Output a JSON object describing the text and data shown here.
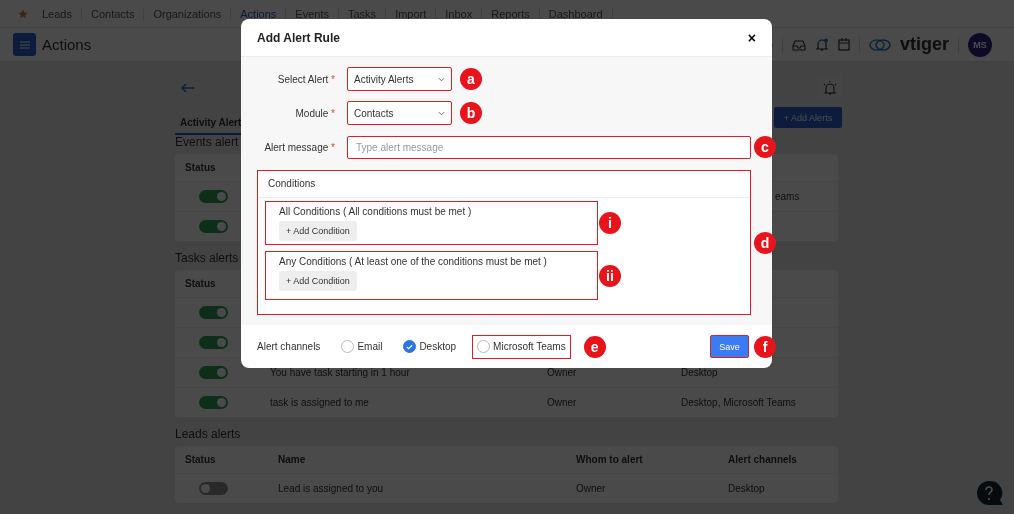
{
  "nav": {
    "items": [
      {
        "label": "Leads",
        "selected": false
      },
      {
        "label": "Contacts",
        "selected": false
      },
      {
        "label": "Organizations",
        "selected": false
      },
      {
        "label": "Actions",
        "selected": true
      },
      {
        "label": "Events",
        "selected": false
      },
      {
        "label": "Tasks",
        "selected": false
      },
      {
        "label": "Import",
        "selected": false
      },
      {
        "label": "Inbox",
        "selected": false
      },
      {
        "label": "Reports",
        "selected": false
      },
      {
        "label": "Dashboard",
        "selected": false
      }
    ]
  },
  "header": {
    "title": "Actions",
    "logo": "vtiger",
    "avatar": "MS"
  },
  "page": {
    "tabs": [
      {
        "label": "Activity Alert",
        "selected": true
      }
    ],
    "add_button": "+ Add Alerts"
  },
  "sections": [
    {
      "title": "Events alert",
      "columns": [
        "Status"
      ],
      "rows": [
        {
          "on": true,
          "channels": "eams"
        },
        {
          "on": true
        }
      ]
    },
    {
      "title": "Tasks alerts",
      "columns": [
        "Status"
      ],
      "rows": [
        {
          "on": true
        },
        {
          "on": true
        },
        {
          "on": true,
          "name": "You have task starting in 1 hour",
          "whom": "Owner",
          "channels": "Desktop"
        },
        {
          "on": true,
          "name": "task is assigned to me",
          "whom": "Owner",
          "channels": "Desktop, Microsoft Teams"
        }
      ]
    },
    {
      "title": "Leads alerts",
      "columns": [
        "Status",
        "Name",
        "Whom to alert",
        "Alert channels"
      ],
      "rows": [
        {
          "on": false,
          "name": "Lead is assigned to you",
          "whom": "Owner",
          "channels": "Desktop"
        }
      ]
    }
  ],
  "modal": {
    "title": "Add Alert Rule",
    "close": "×",
    "fields": [
      {
        "kind": "select",
        "label": "Select Alert",
        "required_mark": "*",
        "value": "Activity Alerts",
        "highlighted": true,
        "badge": "a"
      },
      {
        "kind": "select",
        "label": "Module",
        "required_mark": "*",
        "value": "Contacts",
        "highlighted": true,
        "badge": "b"
      },
      {
        "kind": "text",
        "label": "Alert message",
        "required_mark": "*",
        "placeholder": "Type alert message",
        "highlighted": true,
        "badge": "c"
      }
    ],
    "conditions": {
      "title": "Conditions",
      "highlighted": true,
      "badge": "d",
      "groups": [
        {
          "title": "All Conditions ( All conditions must be met )",
          "button": "+ Add Condition",
          "highlighted": true,
          "badge": "i"
        },
        {
          "title": "Any Conditions ( At least one of the conditions must be met )",
          "button": "+ Add Condition",
          "highlighted": true,
          "badge": "ii"
        }
      ]
    },
    "channels_label": "Alert channels",
    "channels": [
      {
        "label": "Email",
        "checked": false
      },
      {
        "label": "Desktop",
        "checked": true
      },
      {
        "label": "Microsoft Teams",
        "checked": false,
        "highlighted": true,
        "badge": "e"
      }
    ],
    "save": {
      "label": "Save",
      "highlighted": true,
      "badge": "f"
    }
  }
}
